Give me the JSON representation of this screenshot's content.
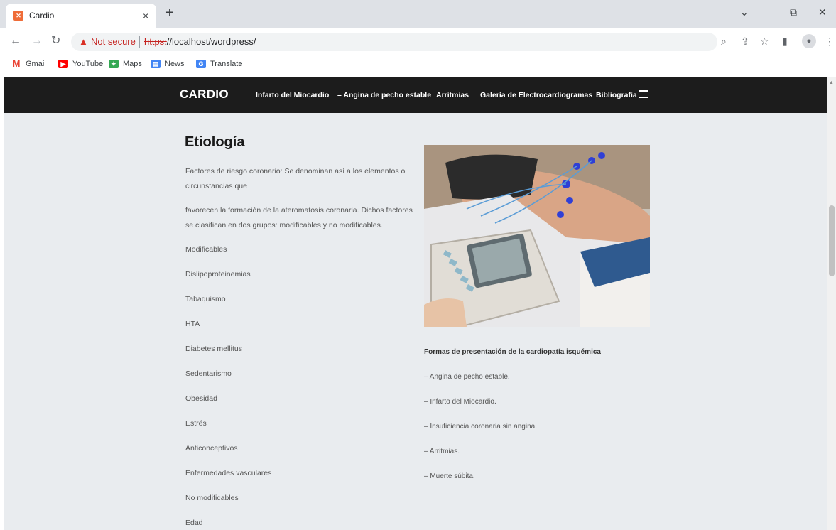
{
  "browser": {
    "tab_title": "Cardio",
    "tab_close": "×",
    "new_tab": "+",
    "win_min": "–",
    "win_restore": "⧉",
    "win_close": "✕",
    "win_list": "⌄",
    "security_text": "Not secure",
    "url_scheme": "https:",
    "url_rest": "//localhost/wordpress/"
  },
  "bookmarks": [
    {
      "label": "Gmail",
      "icon": "gmail-icon",
      "color": "#ea4335",
      "glyph": "M"
    },
    {
      "label": "YouTube",
      "icon": "youtube-icon",
      "color": "#ff0000",
      "glyph": "▶"
    },
    {
      "label": "Maps",
      "icon": "maps-icon",
      "color": "#34a853",
      "glyph": "✦"
    },
    {
      "label": "News",
      "icon": "news-icon",
      "color": "#4285f4",
      "glyph": "▤"
    },
    {
      "label": "Translate",
      "icon": "translate-icon",
      "color": "#4285f4",
      "glyph": "G"
    }
  ],
  "site": {
    "logo": "CARDIO",
    "nav": [
      "Infarto del Miocardio",
      "– Angina de pecho estable",
      "Arritmias",
      "Galería de Electrocardiogramas",
      "Bibliografia"
    ]
  },
  "content": {
    "heading": "Etiología",
    "para1": "Factores de riesgo coronario: Se denominan así a los elementos o circunstancias que",
    "para2": "favorecen la formación de la ateromatosis coronaria. Dichos factores se clasifican en dos grupos: modificables y no modificables.",
    "items": [
      "Modificables",
      "Dislipoproteinemias",
      "Tabaquismo",
      "HTA",
      "Diabetes mellitus",
      "Sedentarismo",
      "Obesidad",
      "Estrés",
      "Anticonceptivos",
      "Enfermedades vasculares",
      "No modificables",
      "Edad"
    ],
    "right_title": "Formas de presentación de la cardiopatía isquémica",
    "right_items": [
      "– Angina de pecho estable.",
      "– Infarto del Miocardio.",
      "– Insuficiencia coronaria sin angina.",
      "– Arritmias.",
      "– Muerte súbita."
    ]
  }
}
